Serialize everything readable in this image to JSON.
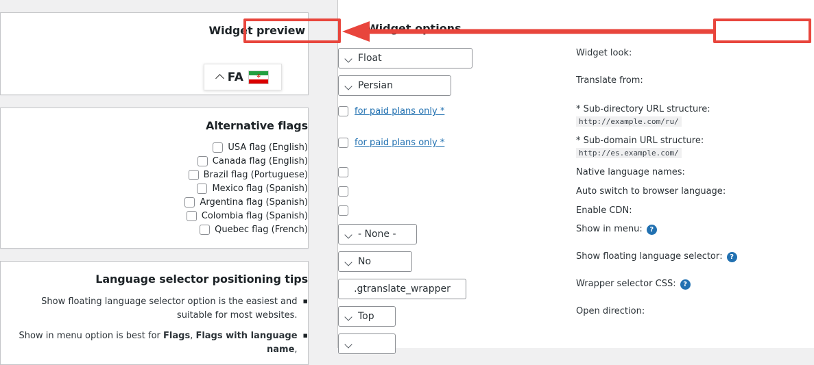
{
  "annotations": {
    "preview_label": "Widget preview",
    "options_label": "Widget options",
    "arrow_color": "#e8453c",
    "box_color": "#e8453c"
  },
  "preview_panel": {
    "title": "Widget preview",
    "widget": {
      "chevron": "chevron-up-icon",
      "language_code": "FA",
      "flag": "iran-flag",
      "flag_colors": [
        "#239f40",
        "#ffffff",
        "#da0000"
      ]
    }
  },
  "alternative_flags": {
    "title": "Alternative flags",
    "items": [
      {
        "label": "USA flag (English)",
        "checked": false
      },
      {
        "label": "Canada flag (English)",
        "checked": false
      },
      {
        "label": "Brazil flag (Portuguese)",
        "checked": false
      },
      {
        "label": "Mexico flag (Spanish)",
        "checked": false
      },
      {
        "label": "Argentina flag (Spanish)",
        "checked": false
      },
      {
        "label": "Colombia flag (Spanish)",
        "checked": false
      },
      {
        "label": "Quebec flag (French)",
        "checked": false
      }
    ]
  },
  "positioning_tips": {
    "title": "Language selector positioning tips",
    "tips": [
      {
        "bullet": "▪",
        "text_plain": "Show floating language selector option is the easiest and suitable for most websites."
      },
      {
        "bullet": "▪",
        "text_prefix": "Show in menu option is best for ",
        "bold_1": "Flags",
        "sep": ", ",
        "bold_2": "Flags with language name",
        "suffix": ","
      }
    ]
  },
  "options_panel": {
    "title": "Widget options",
    "rows": [
      {
        "id": "widget-look",
        "label": ":Widget look",
        "control": "select",
        "value": "Float",
        "help": false
      },
      {
        "id": "translate-from",
        "label": ":Translate from",
        "control": "select",
        "value": "Persian",
        "help": false
      },
      {
        "id": "sub-directory-url-structure",
        "label": ":Sub-directory URL structure *",
        "code_hint": "http://example.com/ru/",
        "control": "checkbox",
        "checked": false,
        "link": "for paid plans only *",
        "help": false
      },
      {
        "id": "sub-domain-url-structure",
        "label": ":Sub-domain URL structure *",
        "code_hint": "http://es.example.com/",
        "control": "checkbox",
        "checked": false,
        "link": "for paid plans only *",
        "help": false
      },
      {
        "id": "native-language-names",
        "label": ":Native language names",
        "control": "checkbox",
        "checked": false,
        "help": false
      },
      {
        "id": "auto-switch-to-browser-language",
        "label": ":Auto switch to browser language",
        "control": "checkbox",
        "checked": false,
        "help": false
      },
      {
        "id": "enable-cdn",
        "label": ":Enable CDN",
        "control": "checkbox",
        "checked": false,
        "help": false
      },
      {
        "id": "show-in-menu",
        "label": ":Show in menu",
        "control": "select",
        "value": "- None -",
        "help": true,
        "help_glyph": "?"
      },
      {
        "id": "show-floating-language-selector",
        "label": ":Show floating language selector",
        "control": "select",
        "value": "No",
        "help": true,
        "help_glyph": "?"
      },
      {
        "id": "wrapper-selector-css",
        "label": ":Wrapper selector CSS",
        "control": "text",
        "value": "gtranslate_wrapper.",
        "help": true,
        "help_glyph": "?"
      },
      {
        "id": "open-direction",
        "label": ":Open direction",
        "control": "select",
        "value": "Top",
        "help": false
      }
    ]
  }
}
